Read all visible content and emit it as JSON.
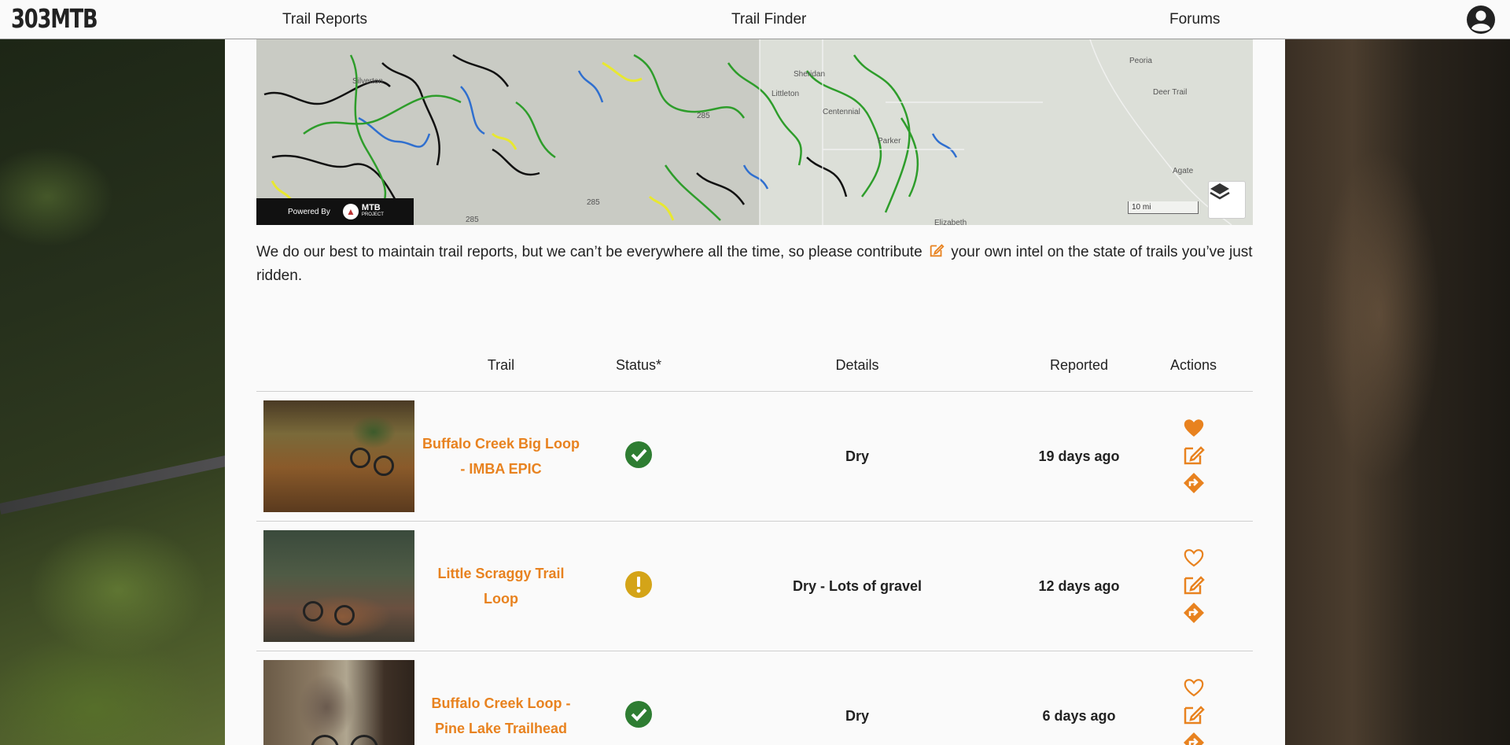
{
  "brand": {
    "logo": "303MTB"
  },
  "nav": {
    "trail_reports": "Trail Reports",
    "trail_finder": "Trail Finder",
    "forums": "Forums"
  },
  "map": {
    "powered_by": "Powered By",
    "provider_name": "MTB",
    "provider_sub": "PROJECT",
    "scale_label": "10 mi",
    "place_labels": [
      "Silverton",
      "Sheridan",
      "Littleton",
      "Centennial",
      "Parker",
      "Peoria",
      "Deer Trail",
      "Agate",
      "Elizabeth",
      "285",
      "285",
      "285"
    ]
  },
  "intro": {
    "text_before": "We do our best to maintain trail reports, but we can’t be everywhere all the time, so please contribute",
    "text_after": "your own intel on the state of trails you’ve just ridden."
  },
  "table": {
    "headers": {
      "trail": "Trail",
      "status": "Status*",
      "details": "Details",
      "reported": "Reported",
      "actions": "Actions"
    },
    "rows": [
      {
        "trail": "Buffalo Creek Big Loop - IMBA EPIC",
        "status": "ok",
        "details": "Dry",
        "reported": "19 days ago",
        "favorited": true
      },
      {
        "trail": "Little Scraggy Trail Loop",
        "status": "caution",
        "details": "Dry - Lots of gravel",
        "reported": "12 days ago",
        "favorited": false
      },
      {
        "trail": "Buffalo Creek Loop - Pine Lake Trailhead",
        "status": "ok",
        "details": "Dry",
        "reported": "6 days ago",
        "favorited": false
      }
    ]
  },
  "colors": {
    "accent": "#e8821f",
    "ok": "#2e7d32",
    "caution": "#d4a418"
  },
  "icons": [
    "user-account-icon",
    "layers-icon",
    "edit-icon",
    "check-circle-icon",
    "exclamation-circle-icon",
    "heart-icon",
    "directions-icon"
  ]
}
